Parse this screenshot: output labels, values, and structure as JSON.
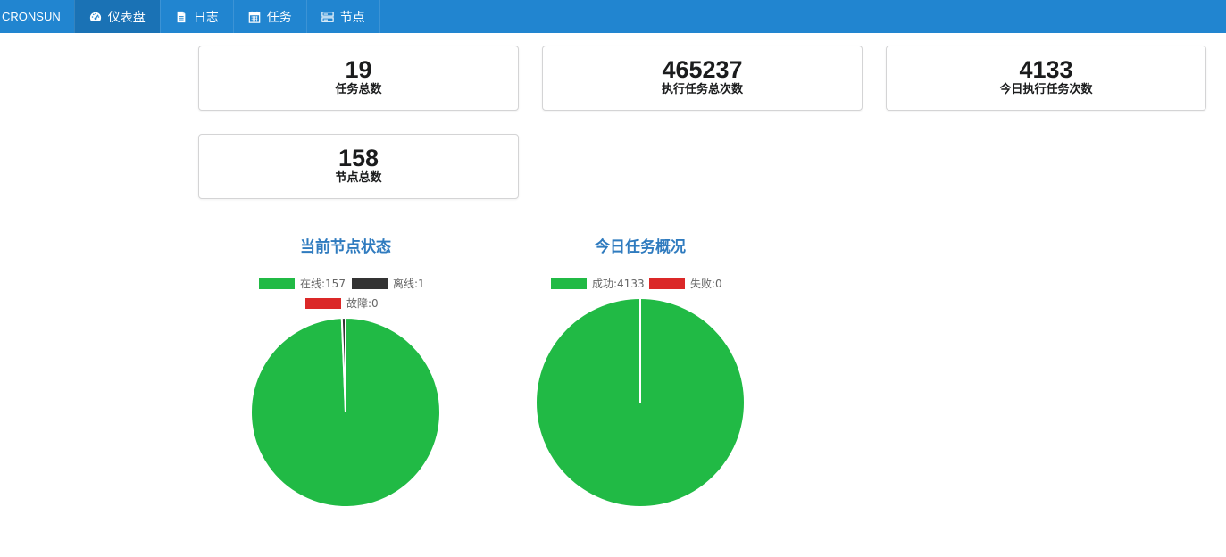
{
  "nav": {
    "brand": "CRONSUN",
    "items": [
      {
        "label": "仪表盘",
        "icon": "dashboard-icon",
        "active": true
      },
      {
        "label": "日志",
        "icon": "file-text-icon",
        "active": false
      },
      {
        "label": "任务",
        "icon": "calendar-icon",
        "active": false
      },
      {
        "label": "节点",
        "icon": "server-icon",
        "active": false
      }
    ]
  },
  "stats": [
    {
      "value": "19",
      "label": "任务总数"
    },
    {
      "value": "465237",
      "label": "执行任务总次数"
    },
    {
      "value": "4133",
      "label": "今日执行任务次数"
    },
    {
      "value": "158",
      "label": "节点总数"
    }
  ],
  "colors": {
    "nav_bg": "#2185d0",
    "success": "#21ba45",
    "offline": "#333333",
    "error": "#db2828",
    "title": "#2f7bbf"
  },
  "chart_data": [
    {
      "type": "pie",
      "title": "当前节点状态",
      "legend_placement": "top",
      "slices": [
        {
          "name": "在线:157",
          "value": 157,
          "color": "#21ba45"
        },
        {
          "name": "离线:1",
          "value": 1,
          "color": "#333333"
        },
        {
          "name": "故障:0",
          "value": 0,
          "color": "#db2828"
        }
      ]
    },
    {
      "type": "pie",
      "title": "今日任务概况",
      "legend_placement": "top",
      "slices": [
        {
          "name": "成功:4133",
          "value": 4133,
          "color": "#21ba45"
        },
        {
          "name": "失败:0",
          "value": 0,
          "color": "#db2828"
        }
      ]
    }
  ]
}
